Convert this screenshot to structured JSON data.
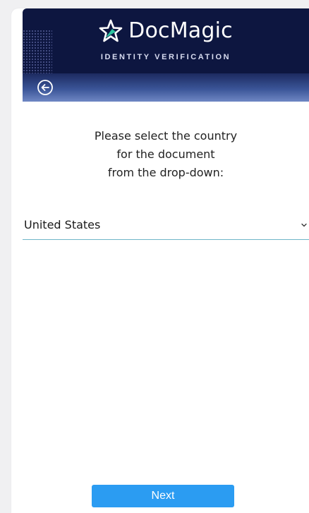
{
  "header": {
    "logo_text": "DocMagic",
    "subtitle": "IDENTITY VERIFICATION",
    "logo_icon": "star-logo-icon",
    "background_color": "#0d1640"
  },
  "nav": {
    "back_icon": "back-arrow-icon"
  },
  "instruction": {
    "line1": "Please select the country",
    "line2": "for the document",
    "line3": "from the drop-down:"
  },
  "country_select": {
    "value": "United States",
    "icon": "chevron-down-icon"
  },
  "actions": {
    "next_label": "Next",
    "next_color": "#2b9cf2"
  }
}
